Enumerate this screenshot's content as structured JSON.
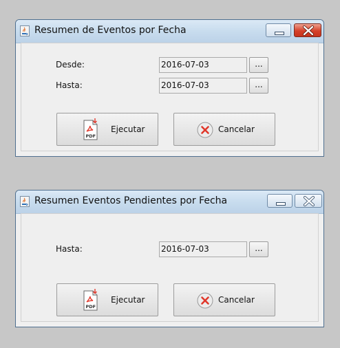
{
  "window1": {
    "title": "Resumen de Eventos por Fecha",
    "desde_label": "Desde:",
    "desde_value": "2016-07-03",
    "hasta_label": "Hasta:",
    "hasta_value": "2016-07-03",
    "browse_label": "...",
    "execute_label": "Ejecutar",
    "cancel_label": "Cancelar",
    "active": true
  },
  "window2": {
    "title": "Resumen Eventos Pendientes por Fecha",
    "hasta_label": "Hasta:",
    "hasta_value": "2016-07-03",
    "browse_label": "...",
    "execute_label": "Ejecutar",
    "cancel_label": "Cancelar",
    "active": false
  },
  "icons": {
    "window_icon": "java-cup-icon",
    "minimize": "minimize-icon",
    "close": "close-icon",
    "execute": "pdf-icon",
    "cancel": "cancel-icon"
  },
  "colors": {
    "desktop_bg": "#c7c7c7",
    "window_bg": "#f0f0f0",
    "titlebar": "#c8dcee",
    "close_active": "#d5412a",
    "pdf_red": "#e23b2e"
  },
  "pdf_icon_text": "PDF"
}
